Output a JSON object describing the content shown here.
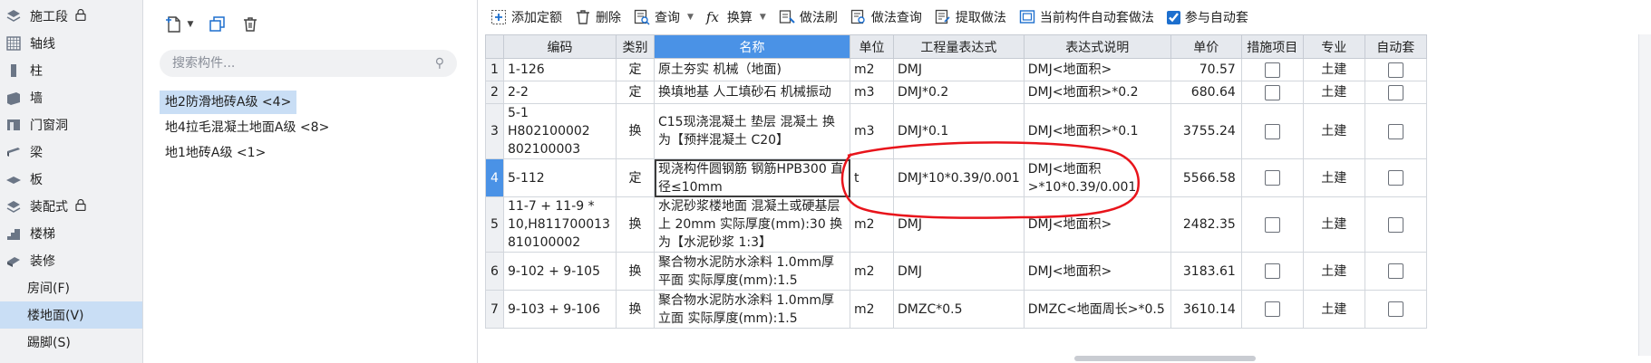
{
  "sidebar": {
    "items": [
      {
        "label": "施工段",
        "icon": "stack-icon",
        "locked": true
      },
      {
        "label": "轴线",
        "icon": "grid-icon"
      },
      {
        "label": "柱",
        "icon": "column-icon"
      },
      {
        "label": "墙",
        "icon": "wall-icon"
      },
      {
        "label": "门窗洞",
        "icon": "door-window-icon"
      },
      {
        "label": "梁",
        "icon": "beam-icon"
      },
      {
        "label": "板",
        "icon": "slab-icon"
      },
      {
        "label": "装配式",
        "icon": "prefab-icon",
        "locked": true
      },
      {
        "label": "楼梯",
        "icon": "stair-icon"
      },
      {
        "label": "装修",
        "icon": "decoration-icon"
      },
      {
        "label": "房间(F)",
        "sub": true
      },
      {
        "label": "楼地面(V)",
        "sub": true,
        "active": true
      },
      {
        "label": "踢脚(S)",
        "sub": true
      }
    ]
  },
  "component_panel": {
    "search_placeholder": "搜索构件...",
    "items": [
      "地2防滑地砖A级 <4>",
      "地4拉毛混凝土地面A级 <8>",
      "地1地砖A级 <1>"
    ],
    "active_index": 0
  },
  "toolbar": {
    "add_quota": "添加定额",
    "delete": "删除",
    "query": "查询",
    "convert": "换算",
    "brush": "做法刷",
    "method_query": "做法查询",
    "extract": "提取做法",
    "auto_method": "当前构件自动套做法",
    "join_auto": "参与自动套"
  },
  "grid": {
    "headers": [
      "编码",
      "类别",
      "名称",
      "单位",
      "工程量表达式",
      "表达式说明",
      "单价",
      "措施项目",
      "专业",
      "自动套"
    ],
    "rows": [
      {
        "no": "1",
        "code": "1-126",
        "type": "定",
        "name": "原土夯实 机械（地面)",
        "unit": "m2",
        "expr": "DMJ",
        "desc": "DMJ<地面积>",
        "price": "70.57",
        "major": "土建"
      },
      {
        "no": "2",
        "code": "2-2",
        "type": "定",
        "name": "换填地基 人工填砂石 机械振动",
        "unit": "m3",
        "expr": "DMJ*0.2",
        "desc": "DMJ<地面积>*0.2",
        "price": "680.64",
        "major": "土建"
      },
      {
        "no": "3",
        "code": "5-1 H802100002 802100003",
        "type": "换",
        "name": "C15现浇混凝土 垫层 混凝土 换为【预拌混凝土 C20】",
        "unit": "m3",
        "expr": "DMJ*0.1",
        "desc": "DMJ<地面积>*0.1",
        "price": "3755.24",
        "major": "土建"
      },
      {
        "no": "4",
        "code": "5-112",
        "type": "定",
        "name": "现浇构件圆钢筋 钢筋HPB300 直径≤10mm",
        "unit": "t",
        "expr": "DMJ*10*0.39/0.001",
        "desc": "DMJ<地面积>*10*0.39/0.001",
        "price": "5566.58",
        "major": "土建"
      },
      {
        "no": "5",
        "code": "11-7 + 11-9 * 10,H811700013 810100002",
        "type": "换",
        "name": "水泥砂浆楼地面 混凝土或硬基层上 20mm 实际厚度(mm):30 换为【水泥砂浆 1:3】",
        "unit": "m2",
        "expr": "DMJ",
        "desc": "DMJ<地面积>",
        "price": "2482.35",
        "major": "土建"
      },
      {
        "no": "6",
        "code": "9-102 + 9-105",
        "type": "换",
        "name": "聚合物水泥防水涂料 1.0mm厚 平面 实际厚度(mm):1.5",
        "unit": "m2",
        "expr": "DMJ",
        "desc": "DMJ<地面积>",
        "price": "3183.61",
        "major": "土建"
      },
      {
        "no": "7",
        "code": "9-103 + 9-106",
        "type": "换",
        "name": "聚合物水泥防水涂料 1.0mm厚 立面 实际厚度(mm):1.5",
        "unit": "m2",
        "expr": "DMZC*0.5",
        "desc": "DMZC<地面周长>*0.5",
        "price": "3610.14",
        "major": "土建"
      }
    ],
    "selected_row": "4"
  },
  "colors": {
    "header_highlight": "#4a92e6",
    "selection": "#c9def5",
    "annotation_red": "#e8141b"
  }
}
